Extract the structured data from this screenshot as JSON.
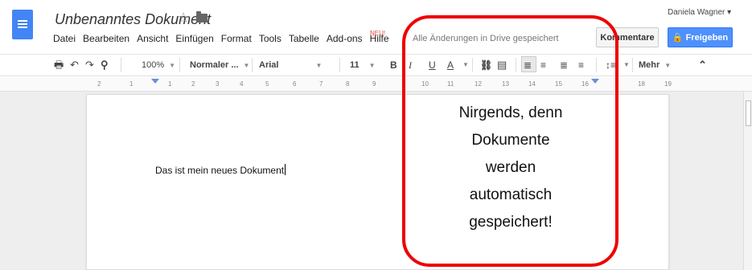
{
  "header": {
    "title": "Unbenanntes Dokument",
    "star": "☆",
    "user": "Daniela Wagner ▾",
    "status": "Alle Änderungen in Drive gespeichert",
    "comments_label": "Kommentare",
    "share_label": "🔒 Freigeben",
    "new_badge": "NEU!"
  },
  "menu": {
    "items": [
      "Datei",
      "Bearbeiten",
      "Ansicht",
      "Einfügen",
      "Format",
      "Tools",
      "Tabelle",
      "Add-ons",
      "Hilfe"
    ]
  },
  "toolbar": {
    "zoom": "100%",
    "style": "Normaler ...",
    "font": "Arial",
    "size": "11",
    "bold": "B",
    "italic": "I",
    "underline": "U",
    "textcolor": "A",
    "more": "Mehr",
    "collapse": "⌃"
  },
  "ruler": {
    "numbers": [
      "2",
      "1",
      "1",
      "2",
      "3",
      "4",
      "5",
      "6",
      "7",
      "8",
      "9",
      "10",
      "11",
      "12",
      "13",
      "14",
      "15",
      "16",
      "18",
      "19"
    ]
  },
  "document": {
    "text": "Das ist mein neues Dokument"
  },
  "callout": {
    "lines": [
      "Nirgends, denn",
      "Dokumente",
      "werden",
      "automatisch",
      "gespeichert!"
    ]
  }
}
